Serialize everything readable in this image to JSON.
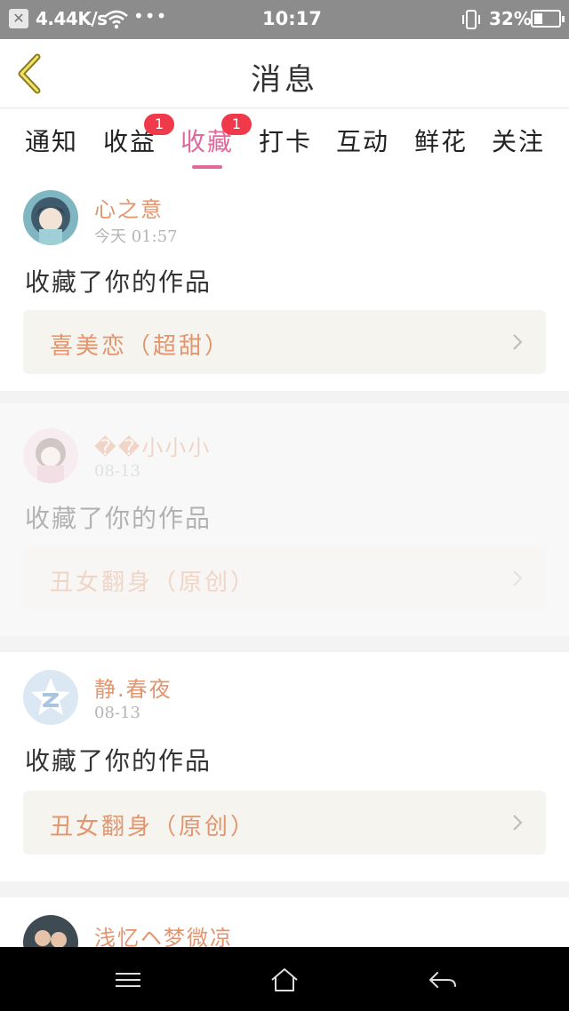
{
  "status_bar": {
    "network_speed": "4.44K/s",
    "dots": "•••",
    "time": "10:17",
    "battery": "32%",
    "notif_glyph": "✕"
  },
  "header": {
    "title": "消息",
    "back_icon": "chevron-left-icon"
  },
  "tabs": [
    {
      "label": "通知",
      "badge": "",
      "active": false
    },
    {
      "label": "收益",
      "badge": "1",
      "active": false
    },
    {
      "label": "收藏",
      "badge": "1",
      "active": true
    },
    {
      "label": "打卡",
      "badge": "",
      "active": false
    },
    {
      "label": "互动",
      "badge": "",
      "active": false
    },
    {
      "label": "鲜花",
      "badge": "",
      "active": false
    },
    {
      "label": "关注",
      "badge": "",
      "active": false
    }
  ],
  "feed": [
    {
      "username": "心之意",
      "time": "今天 01:57",
      "action": "收藏了你的作品",
      "work": "喜美恋（超甜）",
      "avatar": "anime-girl-avatar"
    },
    {
      "username": "��小小小",
      "time": "08-13",
      "action": "收藏了你的作品",
      "work": "丑女翻身（原创）",
      "avatar": "anime-girl-pink-avatar"
    },
    {
      "username": "静.春夜",
      "time": "08-13",
      "action": "收藏了你的作品",
      "work": "丑女翻身（原创）",
      "avatar": "qzone-star-avatar"
    },
    {
      "username": "浅忆ヘ梦微凉",
      "time": "",
      "action": "",
      "work": "",
      "avatar": "couple-photo-avatar"
    }
  ],
  "colors": {
    "accent_pink": "#e0699b",
    "username_orange": "#e2956e",
    "badge_red": "#f0394a",
    "work_box_bg": "#f5f4ee"
  },
  "navbar": {
    "icons": [
      "menu-icon",
      "home-icon",
      "back-arrow-icon"
    ]
  }
}
